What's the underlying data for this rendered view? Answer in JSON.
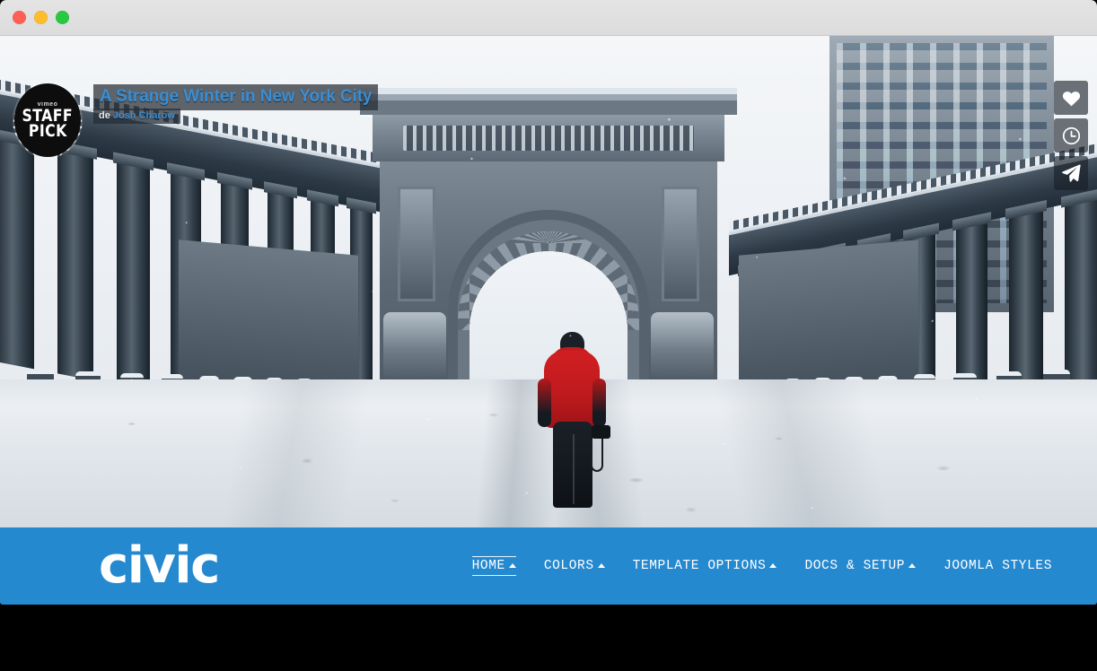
{
  "window": {
    "traffic_lights": [
      {
        "name": "close",
        "color": "#ff5f57"
      },
      {
        "name": "minimize",
        "color": "#ffbd2e"
      },
      {
        "name": "zoom",
        "color": "#28c840"
      }
    ]
  },
  "video": {
    "title": "A Strange Winter in New York City",
    "by_prefix": "de",
    "author": "Josh Charow",
    "title_color": "#3a8ed4",
    "badge": {
      "brand": "vimeo",
      "line1": "STAFF",
      "line2": "PICK"
    },
    "actions": [
      {
        "icon": "heart-icon",
        "label": "Like"
      },
      {
        "icon": "clock-icon",
        "label": "Watch Later"
      },
      {
        "icon": "share-icon",
        "label": "Share"
      }
    ],
    "scene": {
      "description": "Snow-covered Manhattan Bridge Arch and colonnade with a person in a red jacket walking away down the snowy road"
    }
  },
  "site": {
    "logo": "civic",
    "accent_color": "#2589d0",
    "footer_color": "#000000",
    "menu": [
      {
        "label": "HOME",
        "has_caret": true,
        "active": true
      },
      {
        "label": "COLORS",
        "has_caret": true,
        "active": false
      },
      {
        "label": "TEMPLATE OPTIONS",
        "has_caret": true,
        "active": false
      },
      {
        "label": "DOCS & SETUP",
        "has_caret": true,
        "active": false
      },
      {
        "label": "JOOMLA STYLES",
        "has_caret": false,
        "active": false
      }
    ]
  }
}
